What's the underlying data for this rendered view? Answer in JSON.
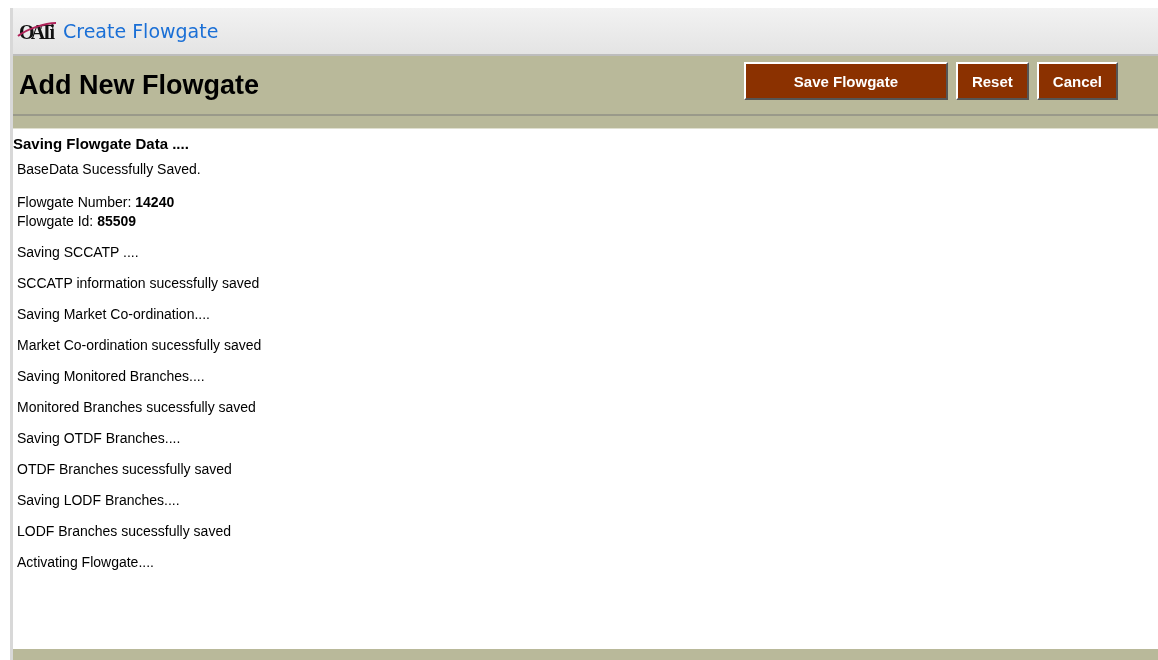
{
  "header": {
    "logo_text": "OATi",
    "title": "Create Flowgate"
  },
  "toolbar": {
    "title": "Add New Flowgate",
    "buttons": [
      "Save Flowgate",
      "Reset",
      "Cancel"
    ]
  },
  "progress": {
    "heading": "Saving Flowgate Data ....",
    "messages": [
      {
        "kind": "line",
        "text": "BaseData Sucessfully Saved."
      },
      {
        "kind": "pair",
        "lines": [
          "Flowgate Number: **14240**",
          "Flowgate Id: **85509**"
        ]
      },
      {
        "kind": "line",
        "text": "Saving SCCATP ...."
      },
      {
        "kind": "line",
        "text": "SCCATP information sucessfully saved"
      },
      {
        "kind": "line",
        "text": "Saving Market Co-ordination...."
      },
      {
        "kind": "line",
        "text": "Market Co-ordination sucessfully saved"
      },
      {
        "kind": "line",
        "text": "Saving Monitored Branches...."
      },
      {
        "kind": "line",
        "text": "Monitored Branches sucessfully saved"
      },
      {
        "kind": "line",
        "text": "Saving OTDF Branches...."
      },
      {
        "kind": "line",
        "text": "OTDF Branches sucessfully saved"
      },
      {
        "kind": "line",
        "text": "Saving LODF Branches...."
      },
      {
        "kind": "line",
        "text": "LODF Branches sucessfully saved"
      },
      {
        "kind": "line",
        "text": "Activating Flowgate...."
      }
    ]
  }
}
